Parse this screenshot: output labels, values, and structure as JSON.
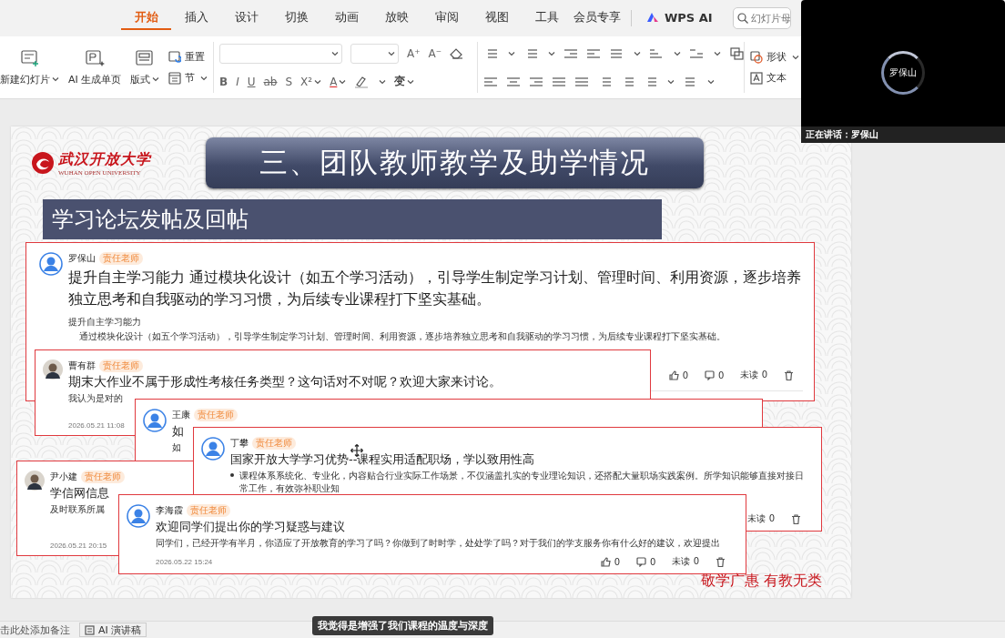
{
  "ribbon_tabs": [
    {
      "label": "开始",
      "selected": true
    },
    {
      "label": "插入",
      "selected": false
    },
    {
      "label": "设计",
      "selected": false
    },
    {
      "label": "切换",
      "selected": false
    },
    {
      "label": "动画",
      "selected": false
    },
    {
      "label": "放映",
      "selected": false
    },
    {
      "label": "审阅",
      "selected": false
    },
    {
      "label": "视图",
      "selected": false
    },
    {
      "label": "工具",
      "selected": false
    },
    {
      "label": "会员专享",
      "selected": false
    }
  ],
  "ai_tab": {
    "label": "WPS AI"
  },
  "search": {
    "placeholder": "幻灯片母"
  },
  "ribbon": {
    "new_slide": "新建幻灯片",
    "ai_page": "AI 生成单页",
    "layout": "版式",
    "reset": "重置",
    "section": "节",
    "size_buttons": [
      "A⁺",
      "A⁻"
    ],
    "format_buttons": [
      "B",
      "I",
      "U",
      "ab",
      "S",
      "X²",
      "A"
    ],
    "effect": "变",
    "shape": "形状",
    "textbox": "文本"
  },
  "slide": {
    "logo": {
      "name": "武汉开放大学",
      "subtitle": "WUHAN OPEN UNIVERSITY"
    },
    "title": "三、团队教师教学及助学情况",
    "subtitle": "学习论坛发帖及回帖",
    "slogan": "敬学广惠 有教无类",
    "posts": [
      {
        "kind": "default",
        "name": "罗保山",
        "badge": "责任老师",
        "title": "提升自主学习能力 通过模块化设计（如五个学习活动），引导学生制定学习计划、管理时间、利用资源，逐步培养独立思考和自我驱动的学习习惯，为后续专业课程打下坚实基础。",
        "subtitle": "提升自主学习能力",
        "body": "通过模块化设计（如五个学习活动），引导学生制定学习计划、管理时间、利用资源，逐步培养独立思考和自我驱动的学习习惯，为后续专业课程打下坚实基础。",
        "footer": {
          "likes": "0",
          "comments": "0",
          "unread": "未读 0"
        }
      },
      {
        "name": "曹有群",
        "badge": "责任老师",
        "title": "期末大作业不属于形成性考核任务类型？这句话对不对呢？欢迎大家来讨论。",
        "body": "我认为是对的",
        "date": "2026.05.21 11:08"
      },
      {
        "kind": "default",
        "name": "王康",
        "badge": "责任老师",
        "title": "如",
        "body": "如"
      },
      {
        "name": "尹小建",
        "badge": "责任老师",
        "title": "学信网信息",
        "body": "及时联系所属",
        "date": "2026.05.21 20:15"
      },
      {
        "kind": "default",
        "name": "丁攀",
        "badge": "责任老师",
        "title": "国家开放大学学习优势--课程实用适配职场，学以致用性高",
        "bullets": [
          "课程体系系统化、专业化，内容贴合行业实际工作场景，不仅涵盖扎实的专业理论知识，还搭配大量职场实践案例。所学知识能够直接对接日常工作，有效弥补职业知"
        ],
        "footer": {
          "unread": "未读 0"
        }
      },
      {
        "kind": "default",
        "name": "李海霞",
        "badge": "责任老师",
        "title": "欢迎同学们提出你的学习疑惑与建议",
        "body": "同学们，已经开学有半月，你适应了开放教育的学习了吗？你做到了时时学，处处学了吗？对于我们的学支服务你有什么好的建议，欢迎提出",
        "date": "2026.05.22 15:24",
        "footer": {
          "likes": "0",
          "comments": "0",
          "unread": "未读 0"
        }
      }
    ]
  },
  "notes": {
    "placeholder": "击此处添加备注",
    "ai_button": "AI 演讲稿"
  },
  "caption": "我觉得是增强了我们课程的温度与深度",
  "video": {
    "participant": "罗保山",
    "speaking": "正在讲话：罗保山"
  }
}
